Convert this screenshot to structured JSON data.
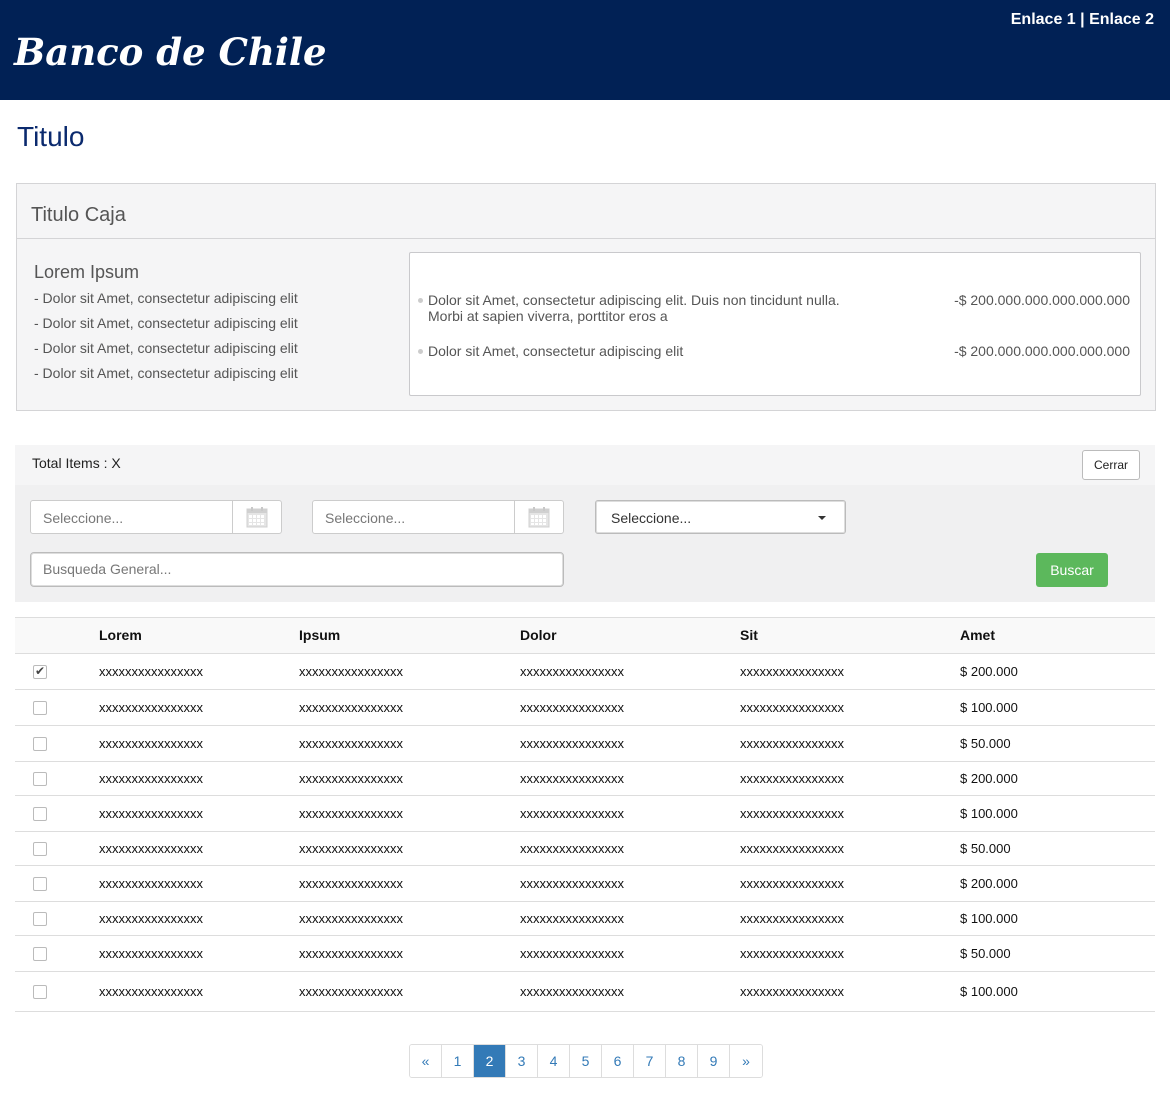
{
  "header": {
    "brand": "Banco de Chile",
    "link1": "Enlace 1",
    "separator": " | ",
    "link2": "Enlace 2"
  },
  "page": {
    "title": "Titulo"
  },
  "box": {
    "title": "Titulo Caja",
    "lorem_title": "Lorem Ipsum",
    "lorem_items": [
      "- Dolor sit Amet, consectetur adipiscing elit",
      "- Dolor sit Amet, consectetur adipiscing elit",
      "- Dolor sit Amet, consectetur adipiscing elit",
      "- Dolor sit Amet, consectetur adipiscing elit"
    ],
    "entries": [
      {
        "text": "Dolor sit Amet, consectetur adipiscing elit. Duis non tincidunt nulla. Morbi at sapien viverra, porttitor eros a",
        "amount": "-$ 200.000.000.000.000.000"
      },
      {
        "text": "Dolor sit Amet, consectetur adipiscing elit",
        "amount": "-$ 200.000.000.000.000.000"
      }
    ]
  },
  "filters": {
    "total_items": "Total Items : X",
    "close_label": "Cerrar",
    "date1_placeholder": "Seleccione...",
    "date2_placeholder": "Seleccione...",
    "select_value": "Seleccione...",
    "search_placeholder": "Busqueda General...",
    "search_button": "Buscar"
  },
  "table": {
    "headers": [
      "Lorem",
      "Ipsum",
      "Dolor",
      "Sit",
      "Amet"
    ],
    "rows": [
      {
        "checked": true,
        "cells": [
          "xxxxxxxxxxxxxxxx",
          "xxxxxxxxxxxxxxxx",
          "xxxxxxxxxxxxxxxx",
          "xxxxxxxxxxxxxxxx",
          "$ 200.000"
        ]
      },
      {
        "checked": false,
        "cells": [
          "xxxxxxxxxxxxxxxx",
          "xxxxxxxxxxxxxxxx",
          "xxxxxxxxxxxxxxxx",
          "xxxxxxxxxxxxxxxx",
          "$ 100.000"
        ]
      },
      {
        "checked": false,
        "cells": [
          "xxxxxxxxxxxxxxxx",
          "xxxxxxxxxxxxxxxx",
          "xxxxxxxxxxxxxxxx",
          "xxxxxxxxxxxxxxxx",
          "$ 50.000"
        ]
      },
      {
        "checked": false,
        "cells": [
          "xxxxxxxxxxxxxxxx",
          "xxxxxxxxxxxxxxxx",
          "xxxxxxxxxxxxxxxx",
          "xxxxxxxxxxxxxxxx",
          "$ 200.000"
        ]
      },
      {
        "checked": false,
        "cells": [
          "xxxxxxxxxxxxxxxx",
          "xxxxxxxxxxxxxxxx",
          "xxxxxxxxxxxxxxxx",
          "xxxxxxxxxxxxxxxx",
          "$ 100.000"
        ]
      },
      {
        "checked": false,
        "cells": [
          "xxxxxxxxxxxxxxxx",
          "xxxxxxxxxxxxxxxx",
          "xxxxxxxxxxxxxxxx",
          "xxxxxxxxxxxxxxxx",
          "$ 50.000"
        ]
      },
      {
        "checked": false,
        "cells": [
          "xxxxxxxxxxxxxxxx",
          "xxxxxxxxxxxxxxxx",
          "xxxxxxxxxxxxxxxx",
          "xxxxxxxxxxxxxxxx",
          "$ 200.000"
        ]
      },
      {
        "checked": false,
        "cells": [
          "xxxxxxxxxxxxxxxx",
          "xxxxxxxxxxxxxxxx",
          "xxxxxxxxxxxxxxxx",
          "xxxxxxxxxxxxxxxx",
          "$ 100.000"
        ]
      },
      {
        "checked": false,
        "cells": [
          "xxxxxxxxxxxxxxxx",
          "xxxxxxxxxxxxxxxx",
          "xxxxxxxxxxxxxxxx",
          "xxxxxxxxxxxxxxxx",
          "$ 50.000"
        ]
      },
      {
        "checked": false,
        "cells": [
          "xxxxxxxxxxxxxxxx",
          "xxxxxxxxxxxxxxxx",
          "xxxxxxxxxxxxxxxx",
          "xxxxxxxxxxxxxxxx",
          "$ 100.000"
        ]
      }
    ]
  },
  "pagination": {
    "prev": "«",
    "pages": [
      "1",
      "2",
      "3",
      "4",
      "5",
      "6",
      "7",
      "8",
      "9"
    ],
    "active_page": "2",
    "next": "»"
  },
  "colors": {
    "header_bg": "#012155",
    "title": "#0b2a6e",
    "search_button": "#5cb85c",
    "pagination_active": "#337ab7"
  }
}
